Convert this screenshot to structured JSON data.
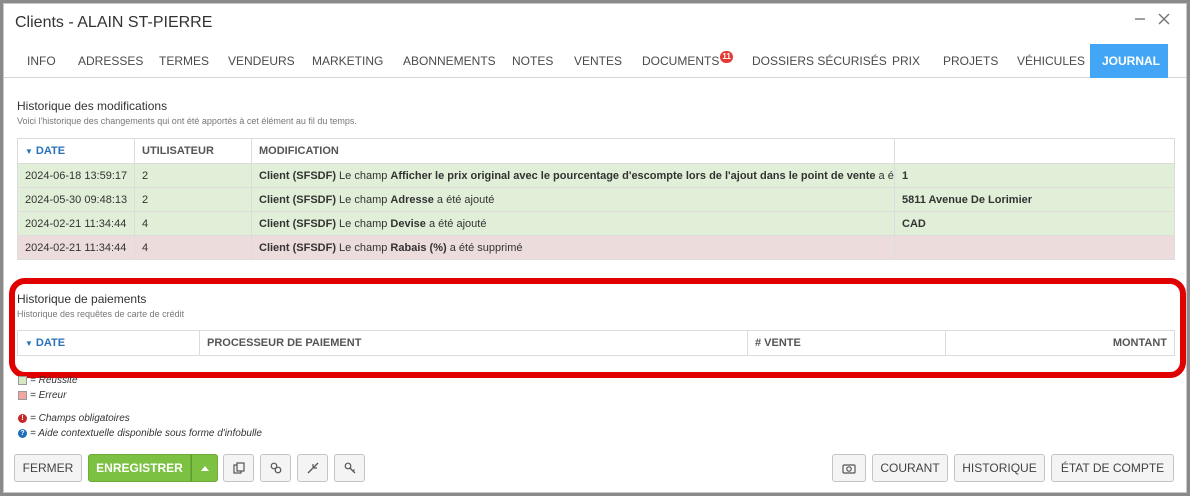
{
  "window": {
    "title": "Clients - ALAIN ST-PIERRE",
    "minimize_icon": "minimize-icon",
    "close_icon": "close-icon"
  },
  "tabs": [
    {
      "label": "INFO"
    },
    {
      "label": "ADRESSES"
    },
    {
      "label": "TERMES"
    },
    {
      "label": "VENDEURS"
    },
    {
      "label": "MARKETING"
    },
    {
      "label": "ABONNEMENTS"
    },
    {
      "label": "NOTES"
    },
    {
      "label": "VENTES"
    },
    {
      "label": "DOCUMENTS",
      "badge": "11"
    },
    {
      "label": "DOSSIERS SÉCURISÉS"
    },
    {
      "label": "PRIX"
    },
    {
      "label": "PROJETS"
    },
    {
      "label": "VÉHICULES"
    },
    {
      "label": "JOURNAL",
      "active": true
    }
  ],
  "modifications": {
    "title": "Historique des modifications",
    "subtitle": "Voici l'historique des changements qui ont été apportés à cet élément au fil du temps.",
    "columns": [
      "DATE",
      "UTILISATEUR",
      "MODIFICATION",
      ""
    ],
    "rows": [
      {
        "status": "ok",
        "date": "2024-06-18 13:59:17",
        "user": "2",
        "entity": "Client (SFSDF)",
        "pre": " Le champ ",
        "field": "Afficher le prix original avec le pourcentage d'escompte lors de l'ajout dans le point de vente",
        "action": " a été ajouté",
        "value": "1"
      },
      {
        "status": "ok",
        "date": "2024-05-30 09:48:13",
        "user": "2",
        "entity": "Client (SFSDF)",
        "pre": " Le champ ",
        "field": "Adresse",
        "action": " a été ajouté",
        "value": "5811 Avenue De Lorimier"
      },
      {
        "status": "ok",
        "date": "2024-02-21 11:34:44",
        "user": "4",
        "entity": "Client (SFSDF)",
        "pre": " Le champ ",
        "field": "Devise",
        "action": " a été ajouté",
        "value": "CAD"
      },
      {
        "status": "err",
        "date": "2024-02-21 11:34:44",
        "user": "4",
        "entity": "Client (SFSDF)",
        "pre": " Le champ ",
        "field": "Rabais (%)",
        "action": " a été supprimé",
        "value": ""
      }
    ]
  },
  "payments": {
    "title": "Historique de paiements",
    "subtitle": "Historique des requêtes de carte de crédit",
    "columns": [
      "DATE",
      "PROCESSEUR DE PAIEMENT",
      "# VENTE",
      "MONTANT"
    ]
  },
  "legend": {
    "success": "= Réussite",
    "error": "= Erreur",
    "required": "= Champs obligatoires",
    "help": "= Aide contextuelle disponible sous forme d'infobulle",
    "success_color": "#d6e8c4",
    "error_color": "#f0a8a0"
  },
  "buttons": {
    "close": "FERMER",
    "save": "ENREGISTRER",
    "current": "COURANT",
    "history": "HISTORIQUE",
    "statement": "ÉTAT DE COMPTE"
  },
  "colors": {
    "accent": "#42a5f5",
    "success_row": "#e1efd8",
    "error_row": "#ecdcdc",
    "save_button": "#7cc142",
    "highlight": "#e00000"
  }
}
